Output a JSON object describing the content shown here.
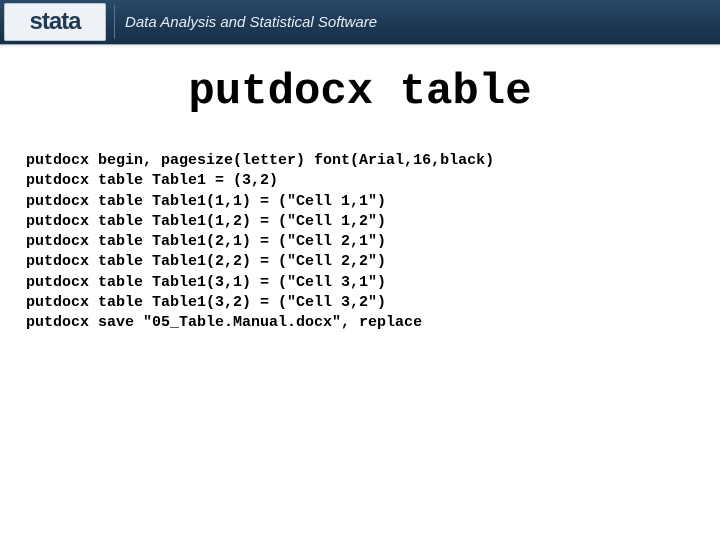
{
  "header": {
    "logo_text": "stata",
    "tagline": "Data Analysis and Statistical Software"
  },
  "title": "putdocx table",
  "code": {
    "lines": [
      "putdocx begin, pagesize(letter) font(Arial,16,black)",
      "putdocx table Table1 = (3,2)",
      "putdocx table Table1(1,1) = (\"Cell 1,1\")",
      "putdocx table Table1(1,2) = (\"Cell 1,2\")",
      "putdocx table Table1(2,1) = (\"Cell 2,1\")",
      "putdocx table Table1(2,2) = (\"Cell 2,2\")",
      "putdocx table Table1(3,1) = (\"Cell 3,1\")",
      "putdocx table Table1(3,2) = (\"Cell 3,2\")",
      "putdocx save \"05_Table.Manual.docx\", replace"
    ]
  }
}
